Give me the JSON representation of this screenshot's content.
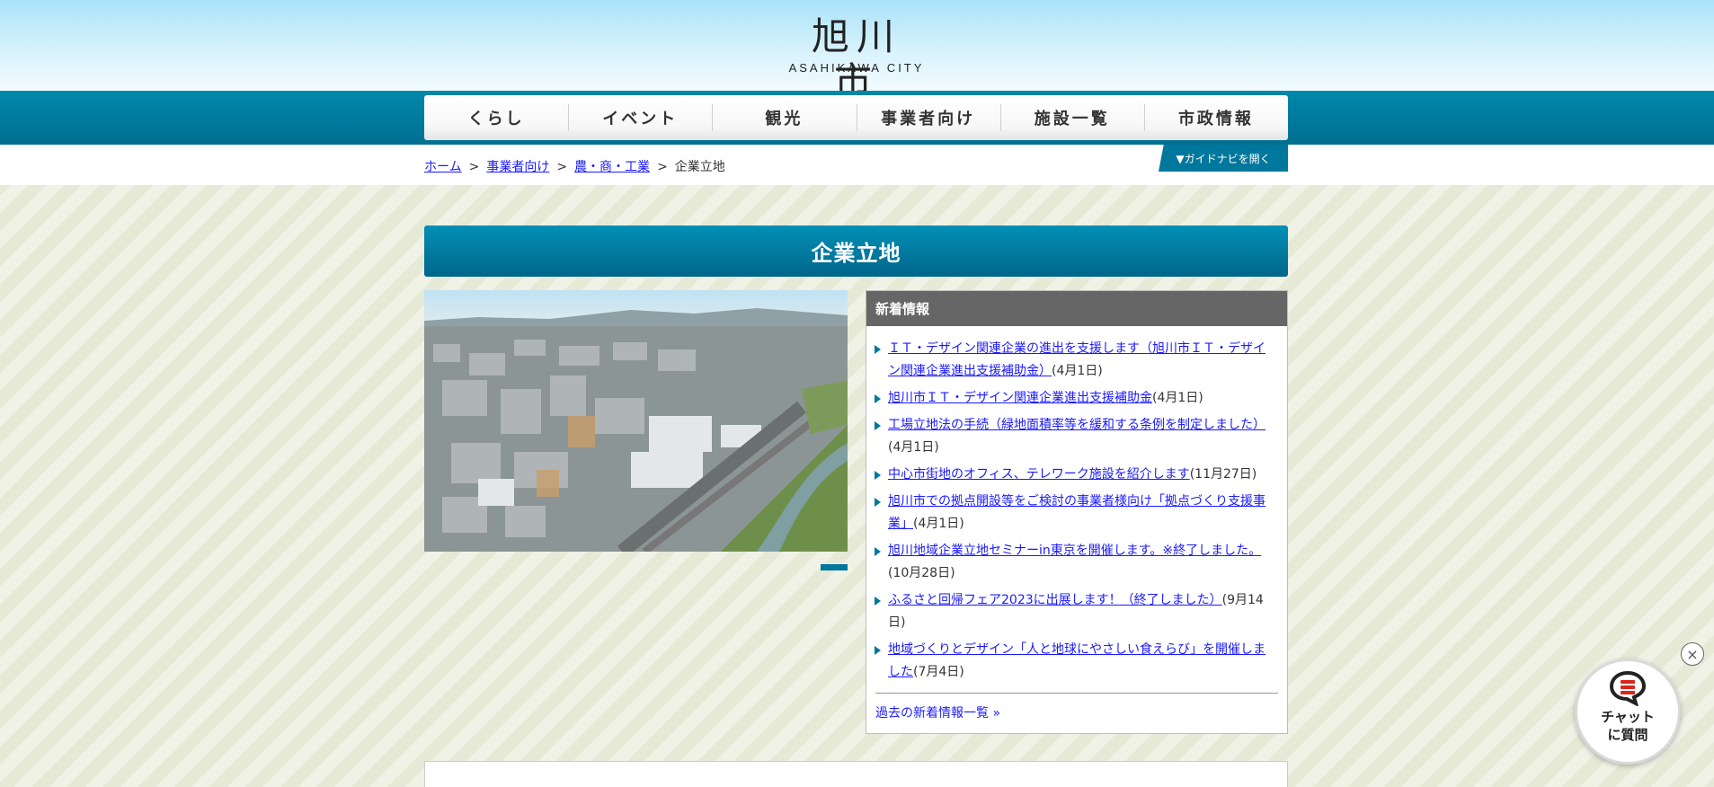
{
  "header": {
    "title": "旭川市",
    "subtitle": "ASAHIKAWA CITY"
  },
  "nav": {
    "items": [
      "くらし",
      "イベント",
      "観光",
      "事業者向け",
      "施設一覧",
      "市政情報"
    ]
  },
  "breadcrumb": {
    "items": [
      {
        "label": "ホーム",
        "link": true
      },
      {
        "label": "事業者向け",
        "link": true
      },
      {
        "label": "農・商・工業",
        "link": true
      },
      {
        "label": "企業立地",
        "link": false
      }
    ],
    "separator": ">"
  },
  "guide_button": "▼ガイドナビを開く",
  "page_heading": "企業立地",
  "news": {
    "heading": "新着情報",
    "items": [
      {
        "title": "ＩＴ・デザイン関連企業の進出を支援します（旭川市ＩＴ・デザイン関連企業進出支援補助金）",
        "date": "(4月1日)"
      },
      {
        "title": "旭川市ＩＴ・デザイン関連企業進出支援補助金",
        "date": "(4月1日)"
      },
      {
        "title": "工場立地法の手続（緑地面積率等を緩和する条例を制定しました）",
        "date": "(4月1日)"
      },
      {
        "title": "中心市街地のオフィス、テレワーク施設を紹介します",
        "date": "(11月27日)"
      },
      {
        "title": "旭川市での拠点開設等をご検討の事業者様向け「拠点づくり支援事業」",
        "date": "(4月1日)"
      },
      {
        "title": "旭川地域企業立地セミナーin東京を開催します。※終了しました。",
        "date": "(10月28日)"
      },
      {
        "title": "ふるさと回帰フェア2023に出展します！（終了しました）",
        "date": "(9月14日)"
      },
      {
        "title": "地域づくりとデザイン「人と地球にやさしい食えらび」を開催しました",
        "date": "(7月4日)"
      }
    ],
    "more_link": "過去の新着情報一覧 »"
  },
  "chat": {
    "label_line1": "チャット",
    "label_line2": "に質問",
    "close": "×"
  },
  "colors": {
    "nav_band": "#0088ab",
    "heading": "#00779c",
    "link": "#1a1aff"
  }
}
